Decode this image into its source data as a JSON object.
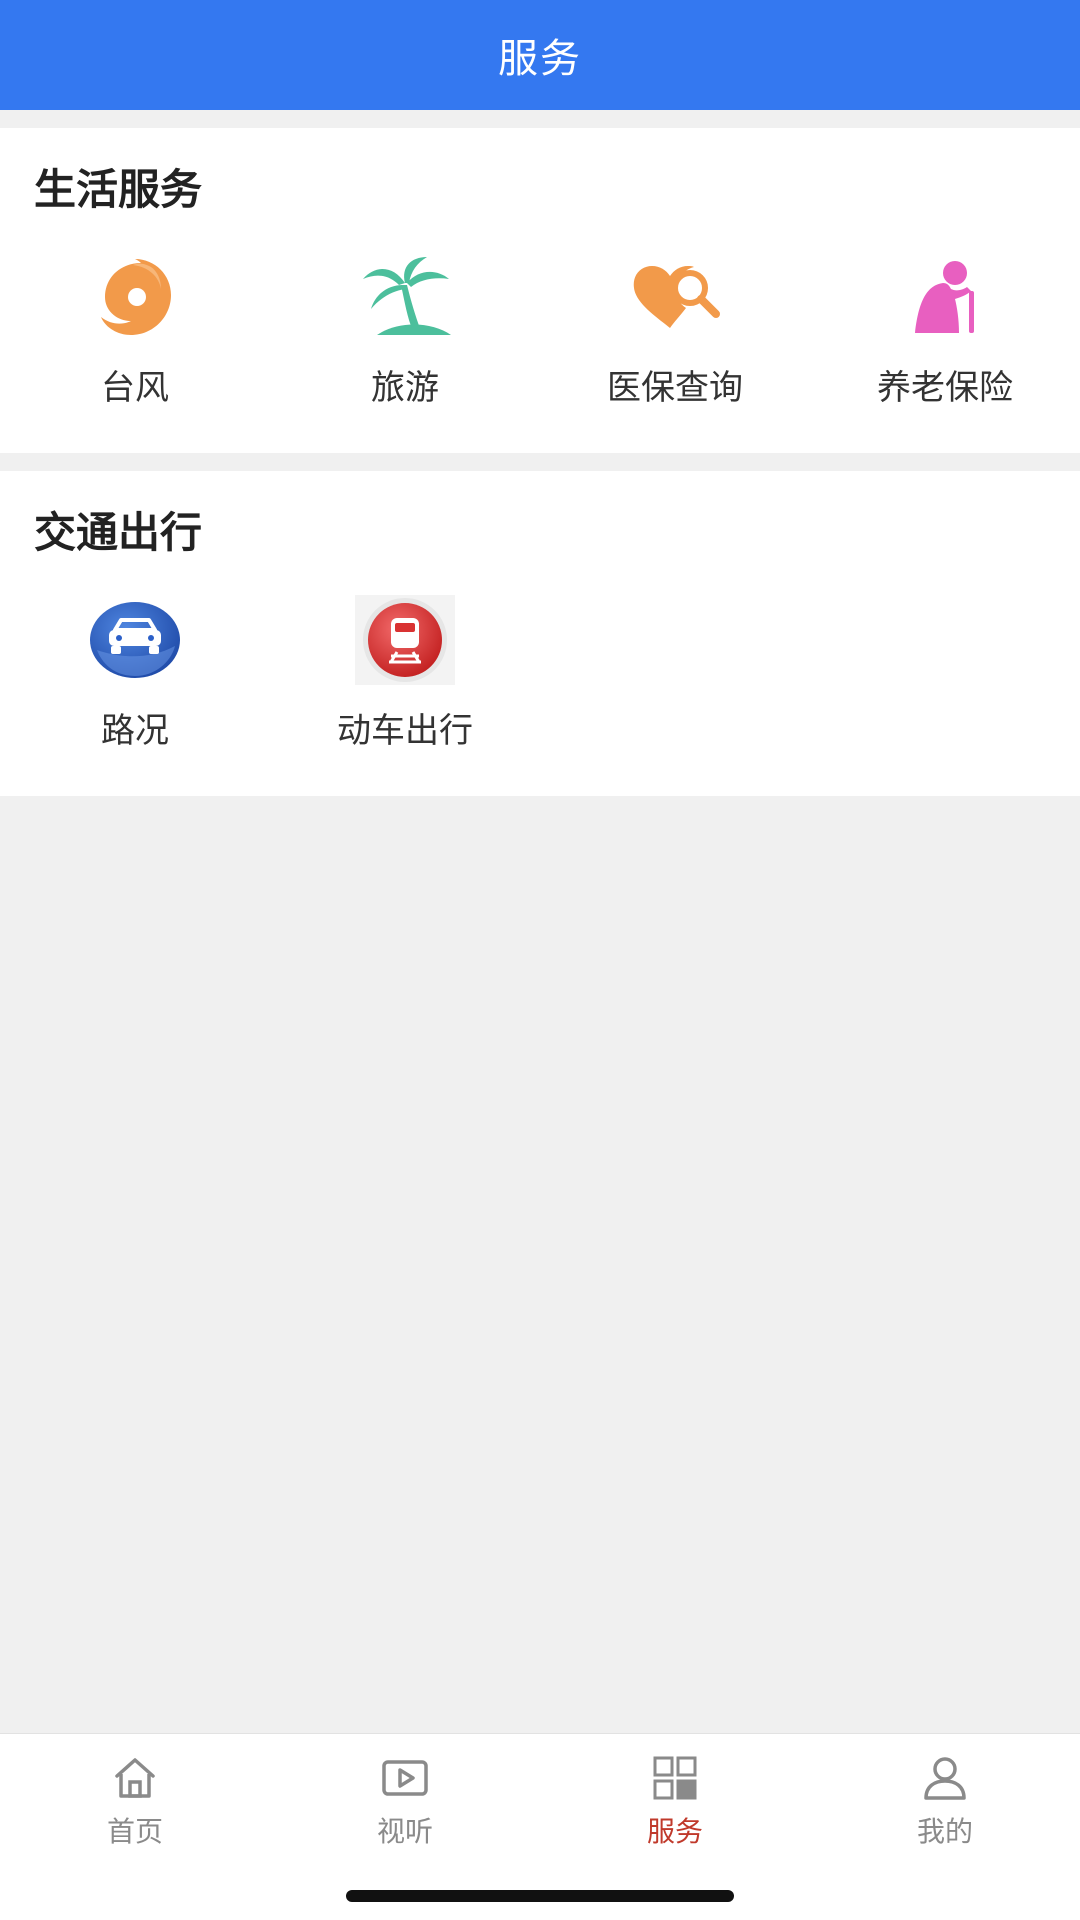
{
  "header": {
    "title": "服务"
  },
  "sections": [
    {
      "title": "生活服务",
      "items": [
        {
          "label": "台风",
          "icon": "typhoon-icon",
          "color": "#f29a4a"
        },
        {
          "label": "旅游",
          "icon": "palm-tree-icon",
          "color": "#4cbf9c"
        },
        {
          "label": "医保查询",
          "icon": "health-search-icon",
          "color": "#f2a24e"
        },
        {
          "label": "养老保险",
          "icon": "elderly-icon",
          "color": "#e85fc0"
        }
      ]
    },
    {
      "title": "交通出行",
      "items": [
        {
          "label": "路况",
          "icon": "car-icon",
          "color": "#2b5fc8"
        },
        {
          "label": "动车出行",
          "icon": "train-icon",
          "color": "#d93232"
        }
      ]
    }
  ],
  "tabbar": {
    "items": [
      {
        "label": "首页",
        "icon": "home-icon",
        "active": false
      },
      {
        "label": "视听",
        "icon": "play-icon",
        "active": false
      },
      {
        "label": "服务",
        "icon": "grid-icon",
        "active": true
      },
      {
        "label": "我的",
        "icon": "user-icon",
        "active": false
      }
    ],
    "active_color": "#c0392b",
    "inactive_color": "#8a8a8a"
  },
  "colors": {
    "header_bg": "#3478f0",
    "page_bg": "#f0f0f0"
  }
}
